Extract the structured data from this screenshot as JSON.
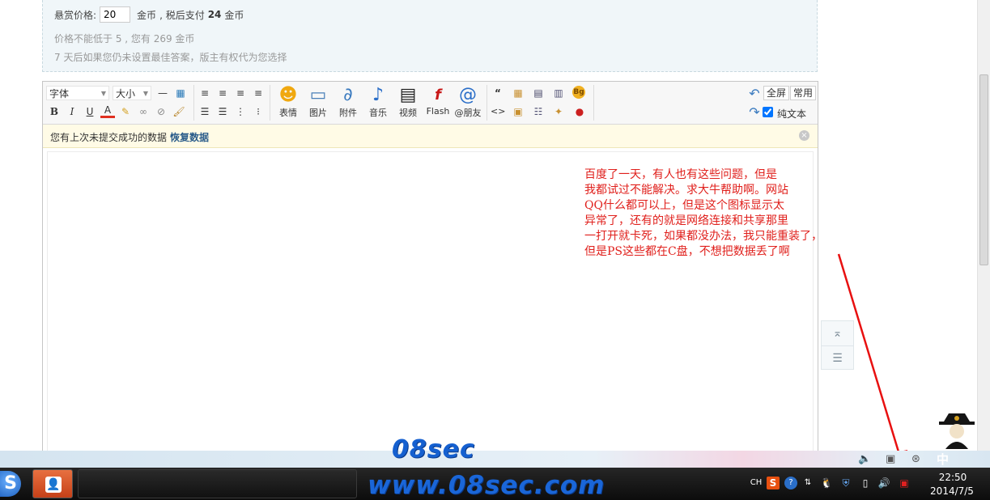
{
  "reward": {
    "label": "悬赏价格:",
    "value": "20",
    "unit": "金币",
    "after_tax_prefix": ", 税后支付",
    "after_tax_value": "24",
    "after_tax_unit": "金币",
    "hint1": "价格不能低于 5 , 您有 269 金币",
    "hint2": "7 天后如果您仍未设置最佳答案，版主有权代为您选择"
  },
  "toolbar": {
    "font_select": "字体",
    "size_select": "大小",
    "emoji_label": "表情",
    "image_label": "图片",
    "attach_label": "附件",
    "music_label": "音乐",
    "video_label": "视频",
    "flash_label": "Flash",
    "friend_label": "@朋友",
    "fullscreen_label": "全屏",
    "common_label": "常用",
    "plaintext_label": "纯文本",
    "quote_glyph": "“",
    "code_glyph": "<>",
    "bg_badge": "Bg"
  },
  "notice": {
    "text": "您有上次未提交成功的数据",
    "link": "恢复数据"
  },
  "annotation": "百度了一天，有人也有这些问题，但是\n我都试过不能解决。求大牛帮助啊。网站\nQQ什么都可以上，但是这个图标显示太\n异常了，还有的就是网络连接和共享那里\n一打开就卡死，如果都没办法，我只能重装了，\n但是PS这些都在C盘，不想把数据丢了啊",
  "watermark": {
    "line1": "08sec",
    "line2": "www.08sec.com"
  },
  "taskbar": {
    "lang": "CH",
    "time": "22:50",
    "date": "2014/7/5",
    "ime": "中"
  },
  "colors": {
    "annotation": "#e0201c",
    "watermark": "#1a66d8",
    "link": "#2a5c8a"
  }
}
